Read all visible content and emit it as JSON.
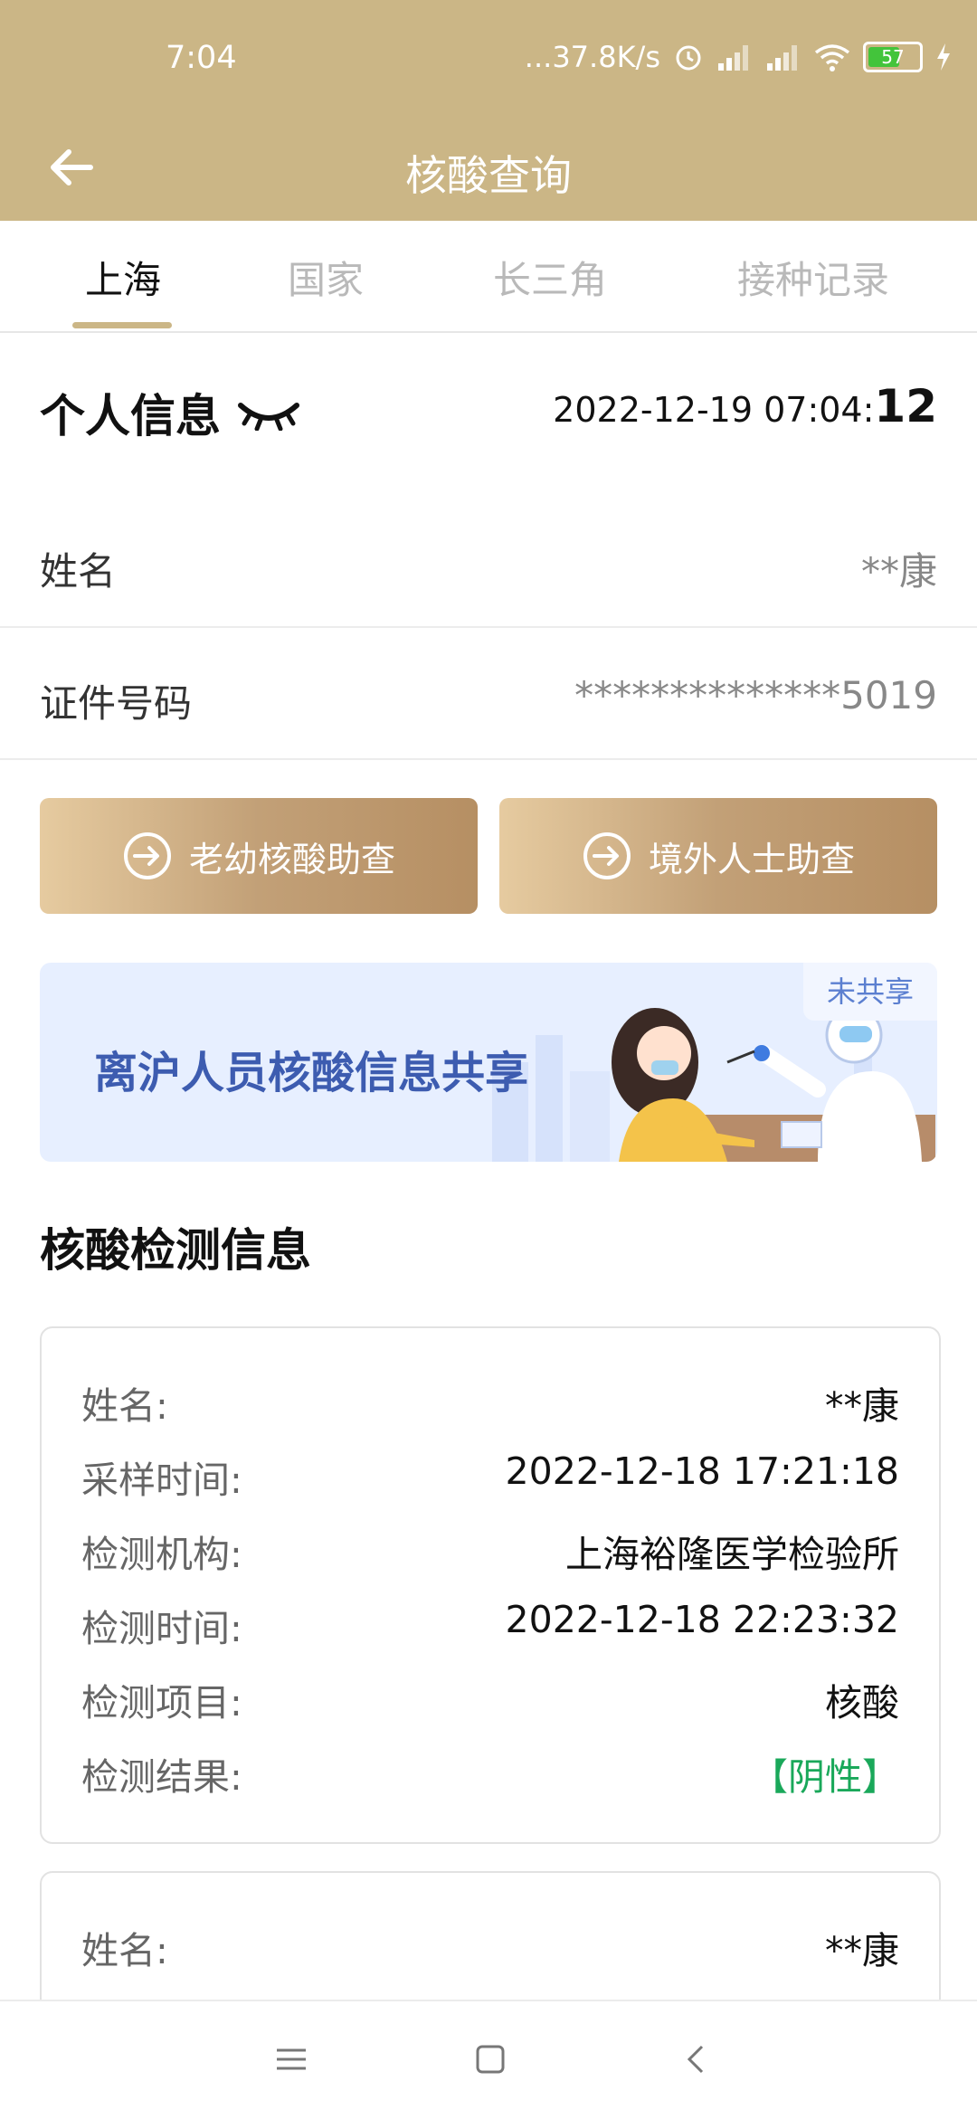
{
  "status_bar": {
    "time": "7:04",
    "network_speed": "...37.8K/s",
    "battery_level": "57"
  },
  "app_bar": {
    "title": "核酸查询",
    "back_icon": "arrow-left-icon"
  },
  "tabs": [
    {
      "label": "上海",
      "active": true
    },
    {
      "label": "国家",
      "active": false
    },
    {
      "label": "长三角",
      "active": false
    },
    {
      "label": "接种记录",
      "active": false
    }
  ],
  "personal_info": {
    "title": "个人信息",
    "timestamp_main": "2022-12-19 07:04:",
    "timestamp_seconds": "12",
    "rows": [
      {
        "label": "姓名",
        "value": "**康"
      },
      {
        "label": "证件号码",
        "value": "**************5019"
      }
    ]
  },
  "buttons": {
    "elderly_assist": "老幼核酸助查",
    "overseas_assist": "境外人士助查"
  },
  "banner": {
    "text": "离沪人员核酸信息共享",
    "tag": "未共享"
  },
  "test_info": {
    "title": "核酸检测信息",
    "cards": [
      {
        "rows": [
          {
            "label": "姓名:",
            "value": "**康"
          },
          {
            "label": "采样时间:",
            "value": "2022-12-18 17:21:18"
          },
          {
            "label": "检测机构:",
            "value": "上海裕隆医学检验所"
          },
          {
            "label": "检测时间:",
            "value": "2022-12-18 22:23:32"
          },
          {
            "label": "检测项目:",
            "value": "核酸"
          },
          {
            "label": "检测结果:",
            "value": "【阴性】"
          }
        ]
      },
      {
        "rows": [
          {
            "label": "姓名:",
            "value": "**康"
          }
        ]
      }
    ]
  },
  "colors": {
    "header": "#cbb686",
    "accent_gold": "#cbb686",
    "negative_green": "#1aa85a",
    "banner_blue": "#3d5cb0"
  }
}
